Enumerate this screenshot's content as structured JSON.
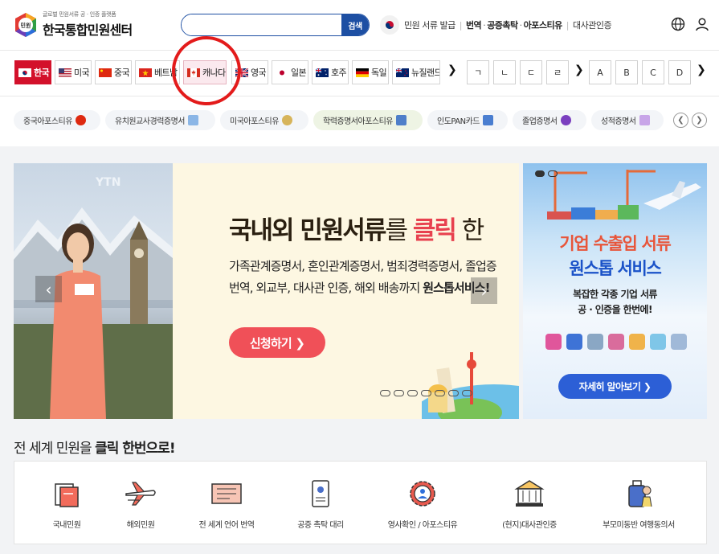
{
  "header": {
    "logo_sub": "글로벌 민원서류 공 · 인증 플랫폼",
    "logo_title": "한국통합민원센터",
    "logo_badge": "민원",
    "search_placeholder": "",
    "search_button": "검색",
    "nav": {
      "item1": "민원 서류 발급",
      "item2": "번역",
      "item3": "공증촉탁",
      "item4": "아포스티유",
      "item5": "대사관인증"
    }
  },
  "countries": [
    {
      "label": "한국"
    },
    {
      "label": "미국"
    },
    {
      "label": "중국"
    },
    {
      "label": "베트남"
    },
    {
      "label": "캐나다"
    },
    {
      "label": "영국"
    },
    {
      "label": "일본"
    },
    {
      "label": "호주"
    },
    {
      "label": "독일"
    },
    {
      "label": "뉴질랜드"
    }
  ],
  "letters": [
    "ㄱ",
    "ㄴ",
    "ㄷ",
    "ㄹ",
    "A",
    "B",
    "C",
    "D"
  ],
  "chips": [
    "중국아포스티유",
    "유치원교사경력증명서",
    "미국아포스티유",
    "학력증명서아포스티유",
    "인도PAN카드",
    "졸업증명서",
    "성적증명서"
  ],
  "main_banner": {
    "video_logo": "YTN",
    "title_part1": "국내외 민원서류",
    "title_part2": "를 ",
    "title_part3": "클릭",
    "title_part4": " 한",
    "desc_line1": "가족관계증명서, 혼인관계증명서, 범죄경력증명서, 졸업증",
    "desc_line2_normal": "번역, 외교부, 대사관 인증, 해외 배송까지 ",
    "desc_line2_bold": "원스톱서비스!",
    "button": "신청하기 ❯"
  },
  "side_banner": {
    "title1": "기업 수출입 서류",
    "title2": "원스톱 서비스",
    "desc1": "복잡한 각종 기업 서류",
    "desc2": "공 · 인증을 한번에!",
    "button": "자세히 알아보기 ❯"
  },
  "services": {
    "heading_normal": "전 세계 민원을 ",
    "heading_bold": "클릭 한번으로!",
    "items": [
      "국내민원",
      "해외민원",
      "전 세계 언어 번역",
      "공증 촉탁 대리",
      "영사확인 / 아포스티유",
      "(현지)대사관인증",
      "부모미동반 여행동의서"
    ]
  },
  "colors": {
    "brand_blue": "#1d4fa3",
    "active_red": "#d3112b",
    "cta_red": "#f05058",
    "side_blue": "#2c5fd6"
  }
}
